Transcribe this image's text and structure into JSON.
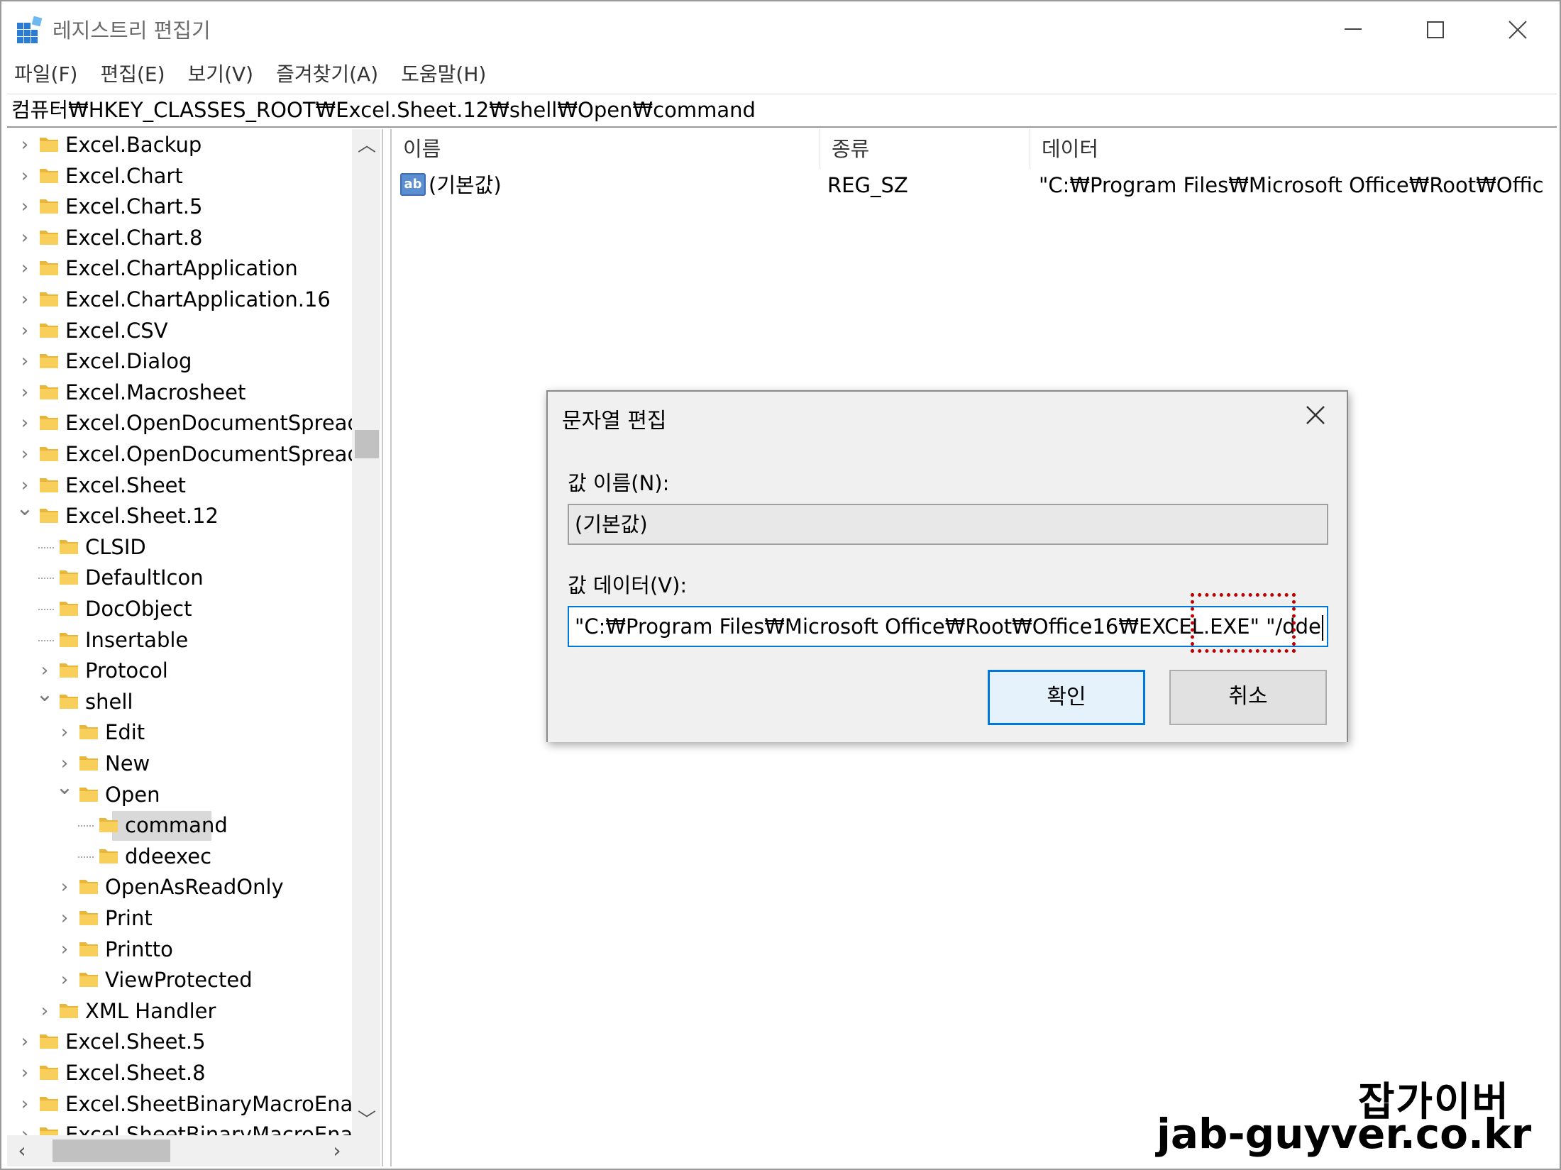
{
  "window": {
    "title": "레지스트리 편집기",
    "minimize": "—",
    "maximize": "☐",
    "close": "✕"
  },
  "menu": [
    "파일(F)",
    "편집(E)",
    "보기(V)",
    "즐겨찾기(A)",
    "도움말(H)"
  ],
  "address": "컴퓨터₩HKEY_CLASSES_ROOT₩Excel.Sheet.12₩shell₩Open₩command",
  "tree": [
    {
      "label": "Excel.Backup",
      "level": 0,
      "chevron": "collapsed"
    },
    {
      "label": "Excel.Chart",
      "level": 0,
      "chevron": "collapsed"
    },
    {
      "label": "Excel.Chart.5",
      "level": 0,
      "chevron": "collapsed"
    },
    {
      "label": "Excel.Chart.8",
      "level": 0,
      "chevron": "collapsed"
    },
    {
      "label": "Excel.ChartApplication",
      "level": 0,
      "chevron": "collapsed"
    },
    {
      "label": "Excel.ChartApplication.16",
      "level": 0,
      "chevron": "collapsed"
    },
    {
      "label": "Excel.CSV",
      "level": 0,
      "chevron": "collapsed"
    },
    {
      "label": "Excel.Dialog",
      "level": 0,
      "chevron": "collapsed"
    },
    {
      "label": "Excel.Macrosheet",
      "level": 0,
      "chevron": "collapsed"
    },
    {
      "label": "Excel.OpenDocumentSpread",
      "level": 0,
      "chevron": "collapsed"
    },
    {
      "label": "Excel.OpenDocumentSpread",
      "level": 0,
      "chevron": "collapsed"
    },
    {
      "label": "Excel.Sheet",
      "level": 0,
      "chevron": "collapsed"
    },
    {
      "label": "Excel.Sheet.12",
      "level": 0,
      "chevron": "expanded"
    },
    {
      "label": "CLSID",
      "level": 1,
      "chevron": "none"
    },
    {
      "label": "DefaultIcon",
      "level": 1,
      "chevron": "none"
    },
    {
      "label": "DocObject",
      "level": 1,
      "chevron": "none"
    },
    {
      "label": "Insertable",
      "level": 1,
      "chevron": "none"
    },
    {
      "label": "Protocol",
      "level": 1,
      "chevron": "collapsed"
    },
    {
      "label": "shell",
      "level": 1,
      "chevron": "expanded"
    },
    {
      "label": "Edit",
      "level": 2,
      "chevron": "collapsed"
    },
    {
      "label": "New",
      "level": 2,
      "chevron": "collapsed"
    },
    {
      "label": "Open",
      "level": 2,
      "chevron": "expanded"
    },
    {
      "label": "command",
      "level": 3,
      "chevron": "none",
      "selected": true
    },
    {
      "label": "ddeexec",
      "level": 3,
      "chevron": "none"
    },
    {
      "label": "OpenAsReadOnly",
      "level": 2,
      "chevron": "collapsed"
    },
    {
      "label": "Print",
      "level": 2,
      "chevron": "collapsed"
    },
    {
      "label": "Printto",
      "level": 2,
      "chevron": "collapsed"
    },
    {
      "label": "ViewProtected",
      "level": 2,
      "chevron": "collapsed"
    },
    {
      "label": "XML Handler",
      "level": 1,
      "chevron": "collapsed"
    },
    {
      "label": "Excel.Sheet.5",
      "level": 0,
      "chevron": "collapsed"
    },
    {
      "label": "Excel.Sheet.8",
      "level": 0,
      "chevron": "collapsed"
    },
    {
      "label": "Excel.SheetBinaryMacroEnab",
      "level": 0,
      "chevron": "collapsed"
    },
    {
      "label": "Excel.SheetBinaryMacroEnab",
      "level": 0,
      "chevron": "collapsed"
    }
  ],
  "list": {
    "columns": [
      "이름",
      "종류",
      "데이터"
    ],
    "rows": [
      {
        "icon": "ab",
        "name": "(기본값)",
        "type": "REG_SZ",
        "data": "\"C:₩Program Files₩Microsoft Office₩Root₩Office..."
      }
    ]
  },
  "dialog": {
    "title": "문자열 편집",
    "name_label": "값 이름(N):",
    "name_value": "(기본값)",
    "data_label": "값 데이터(V):",
    "data_value": "\"C:₩Program Files₩Microsoft Office₩Root₩Office16₩EXCEL.EXE\" \"/dde",
    "ok": "확인",
    "cancel": "취소",
    "close": "✕"
  },
  "watermark": {
    "line1": "잡가이버",
    "line2": "jab-guyver.co.kr"
  },
  "colors": {
    "accent": "#0078d7",
    "highlight": "#c00000",
    "folder": "#f4c542",
    "selection": "#d9d9d9"
  }
}
